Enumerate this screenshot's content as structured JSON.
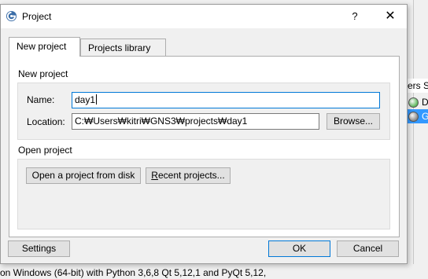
{
  "background_app": {
    "column_header": "ers S",
    "rows": [
      {
        "label": "D",
        "status_color": "#5cb85c",
        "selected": false
      },
      {
        "label": "G",
        "status_color": "#888888",
        "selected": true
      }
    ],
    "status_text": "on Windows (64-bit) with Python 3,6,8 Qt 5,12,1 and PyQt 5,12,"
  },
  "dialog": {
    "title": "Project",
    "help_glyph": "?",
    "close_glyph": "✕",
    "tabs": [
      {
        "label": "New project",
        "active": true
      },
      {
        "label": "Projects library",
        "active": false
      }
    ],
    "new_project": {
      "group_title": "New project",
      "name_label": "Name:",
      "name_value": "day1",
      "location_label": "Location:",
      "location_value": "C:₩Users₩kitri₩GNS3₩projects₩day1",
      "browse_label": "Browse..."
    },
    "open_project": {
      "group_title": "Open project",
      "open_button": "Open a project from disk",
      "recent_button_underlined": "R",
      "recent_button_rest": "ecent projects..."
    },
    "buttons": {
      "settings": "Settings",
      "ok": "OK",
      "cancel": "Cancel"
    }
  }
}
